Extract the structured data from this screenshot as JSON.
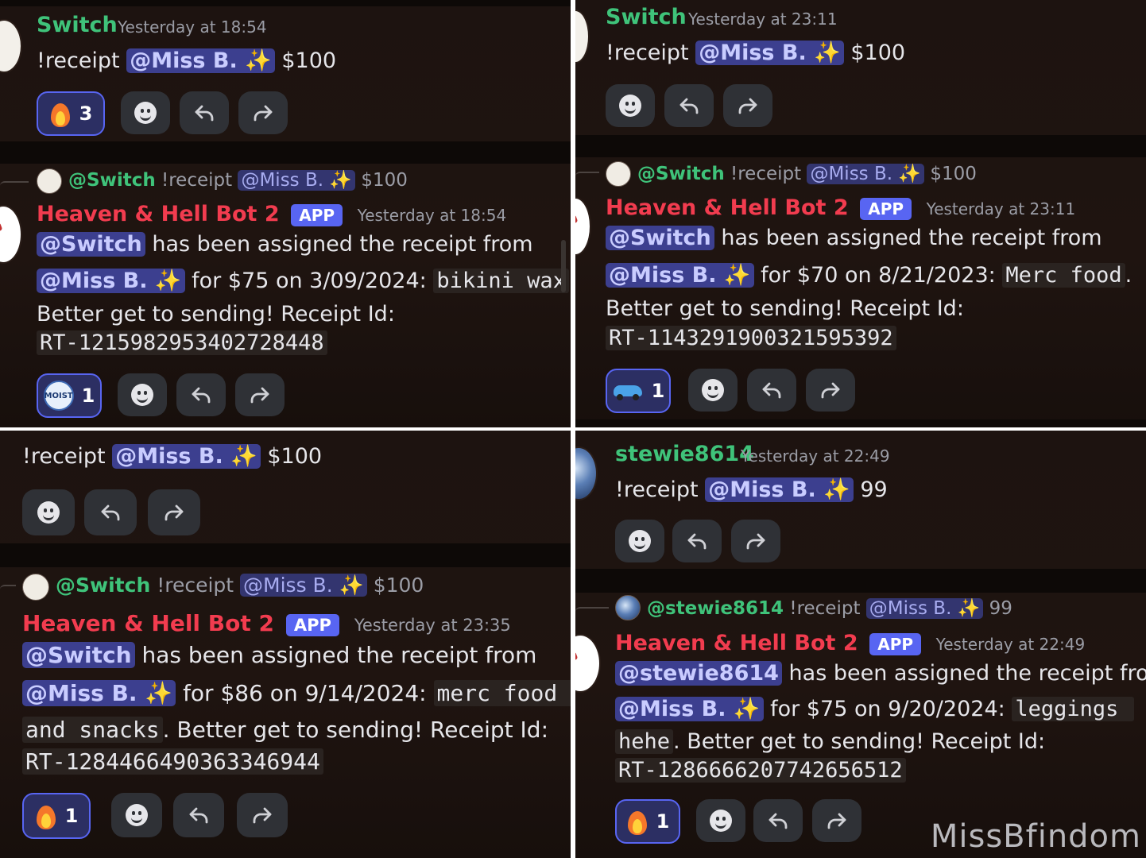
{
  "panels": [
    {
      "id": "top-left",
      "first_message": {
        "author": "Switch",
        "timestamp": "Yesterday at 18:54",
        "command": "!receipt",
        "mention": "@Miss B.",
        "amount": "$100",
        "reaction": {
          "emoji": "fire",
          "count": "3"
        }
      },
      "reply_preview": {
        "mention_user": "@Switch",
        "command": "!receipt",
        "mention": "@Miss B.",
        "amount": "$100"
      },
      "bot_message": {
        "author": "Heaven & Hell Bot 2",
        "badge": "APP",
        "timestamp": "Yesterday at 18:54",
        "mention_user": "@Switch",
        "text_assigned": "has been assigned the receipt from",
        "mention": "@Miss B.",
        "text_for": "for $75 on 3/09/2024:",
        "item": "bikini wax",
        "period": ".",
        "text_better": "Better get to sending! Receipt Id:",
        "receipt_id": "RT-1215982953402728448",
        "reaction": {
          "emoji": "moist",
          "count": "1"
        }
      }
    },
    {
      "id": "top-right",
      "first_message": {
        "author": "Switch",
        "timestamp": "Yesterday at 23:11",
        "command": "!receipt",
        "mention": "@Miss B.",
        "amount": "$100"
      },
      "reply_preview": {
        "mention_user": "@Switch",
        "command": "!receipt",
        "mention": "@Miss B.",
        "amount": "$100"
      },
      "bot_message": {
        "author": "Heaven & Hell Bot 2",
        "badge": "APP",
        "timestamp": "Yesterday at 23:11",
        "mention_user": "@Switch",
        "text_assigned": "has been assigned the receipt from",
        "mention": "@Miss B.",
        "text_for": "for $70 on 8/21/2023:",
        "item": "Merc food",
        "period": ".",
        "text_better": "Better get to sending! Receipt Id:",
        "receipt_id": "RT-1143291900321595392",
        "reaction": {
          "emoji": "car",
          "count": "1"
        }
      }
    },
    {
      "id": "bottom-left",
      "first_message": {
        "command": "!receipt",
        "mention": "@Miss B.",
        "amount": "$100"
      },
      "reply_preview": {
        "mention_user": "@Switch",
        "command": "!receipt",
        "mention": "@Miss B.",
        "amount": "$100"
      },
      "bot_message": {
        "author": "Heaven & Hell Bot 2",
        "badge": "APP",
        "timestamp": "Yesterday at 23:35",
        "mention_user": "@Switch",
        "text_assigned": "has been assigned the receipt from",
        "mention": "@Miss B.",
        "text_for": "for $86 on 9/14/2024:",
        "item": "merc food",
        "item_cont": "and snacks",
        "text_better": ". Better get to sending! Receipt Id:",
        "receipt_id": "RT-1284466490363346944",
        "reaction": {
          "emoji": "fire",
          "count": "1"
        }
      }
    },
    {
      "id": "bottom-right",
      "first_message": {
        "author": "stewie8614",
        "timestamp": "Yesterday at 22:49",
        "command": "!receipt",
        "mention": "@Miss B.",
        "amount": "99"
      },
      "reply_preview": {
        "mention_user": "@stewie8614",
        "command": "!receipt",
        "mention": "@Miss B.",
        "amount": "99"
      },
      "bot_message": {
        "author": "Heaven & Hell Bot 2",
        "badge": "APP",
        "timestamp": "Yesterday at 22:49",
        "mention_user": "@stewie8614",
        "text_assigned": "has been assigned the receipt from",
        "mention": "@Miss B.",
        "text_for": "for $75 on 9/20/2024:",
        "item": "leggings",
        "item_cont": "hehe",
        "text_better": ". Better get to sending! Receipt Id:",
        "receipt_id": "RT-1286666207742656512",
        "reaction": {
          "emoji": "fire",
          "count": "1"
        }
      }
    }
  ],
  "sparkle": "✨",
  "watermark": "MissBfindom",
  "icons": [
    "smiley-add-reaction-icon",
    "reply-arrow-icon",
    "forward-arrow-icon"
  ]
}
